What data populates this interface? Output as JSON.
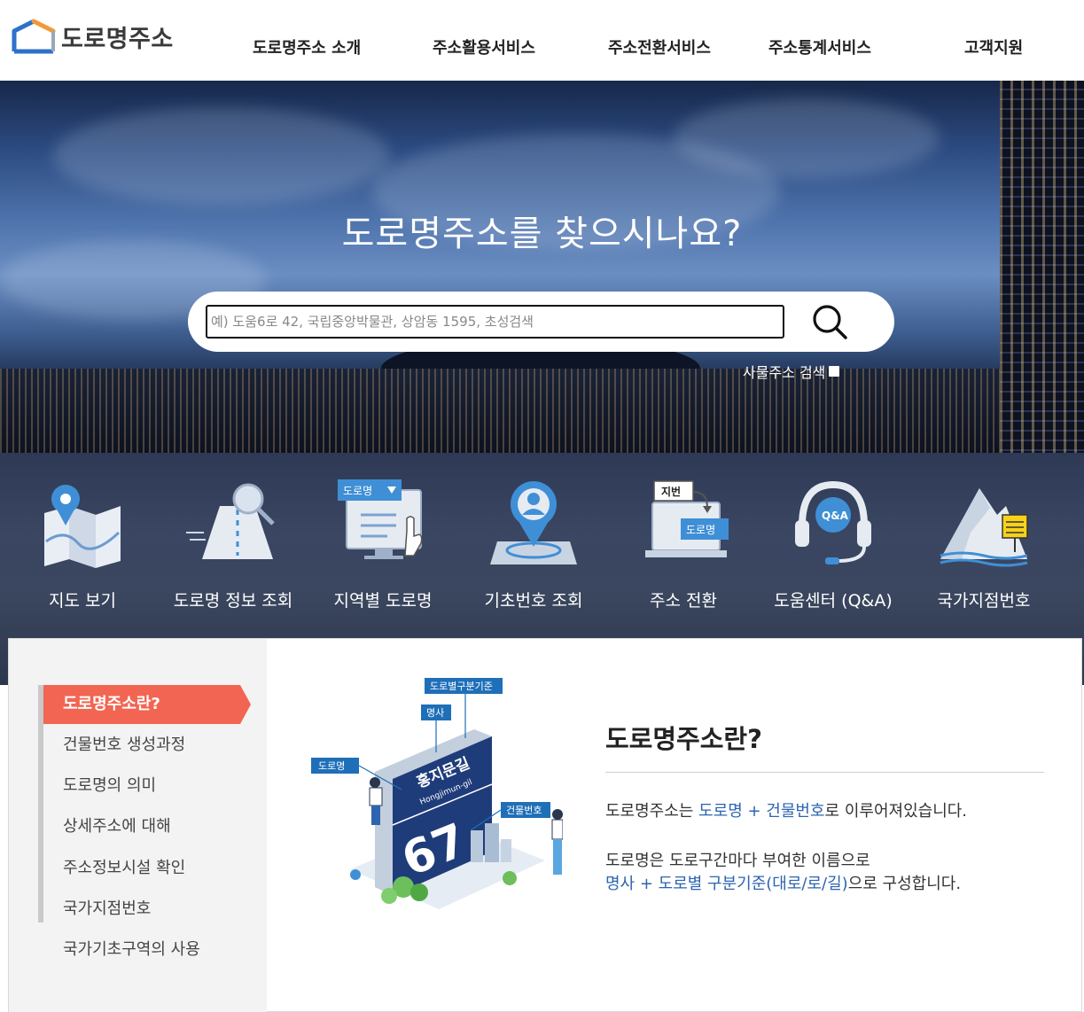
{
  "header": {
    "logo_text": "도로명주소",
    "nav": [
      "도로명주소 소개",
      "주소활용서비스",
      "주소전환서비스",
      "주소통계서비스",
      "고객지원"
    ]
  },
  "hero": {
    "title": "도로명주소를 찾으시나요?",
    "search_placeholder": "예) 도움6로 42, 국립중앙박물관, 상암동 1595, 초성검색",
    "sub_search_label": "사물주소 검색"
  },
  "quick_menu": [
    {
      "label": "지도 보기",
      "icon": "map-icon"
    },
    {
      "label": "도로명 정보 조회",
      "icon": "road-info-icon"
    },
    {
      "label": "지역별 도로명",
      "icon": "region-road-icon"
    },
    {
      "label": "기초번호 조회",
      "icon": "base-number-icon"
    },
    {
      "label": "주소 전환",
      "icon": "address-convert-icon"
    },
    {
      "label": "도움센터 (Q&A)",
      "icon": "help-center-icon"
    },
    {
      "label": "국가지점번호",
      "icon": "national-point-icon"
    }
  ],
  "quick_icon_texts": {
    "road_dropdown": "도로명",
    "jibun": "지번",
    "doro": "도로명",
    "qa": "Q&A"
  },
  "side_menu": [
    {
      "label": "도로명주소란?",
      "active": true
    },
    {
      "label": "건물번호 생성과정",
      "active": false
    },
    {
      "label": "도로명의 의미",
      "active": false
    },
    {
      "label": "상세주소에 대해",
      "active": false
    },
    {
      "label": "주소정보시설 확인",
      "active": false
    },
    {
      "label": "국가지점번호",
      "active": false
    },
    {
      "label": "국가기초구역의 사용",
      "active": false
    }
  ],
  "illustration": {
    "tag_criteria": "도로별구분기준",
    "tag_noun": "명사",
    "tag_road": "도로명",
    "tag_building": "건물번호",
    "sign_road_kr": "홍지문길",
    "sign_road_en": "Hongjimun-gil",
    "sign_number": "67"
  },
  "section": {
    "title": "도로명주소란?",
    "p1_pre": "도로명주소는 ",
    "p1_hl": "도로명 + 건물번호",
    "p1_post": "로 이루어져있습니다.",
    "p2_line1": "도로명은 도로구간마다 부여한 이름으로",
    "p2_hl": "명사 + 도로별 구분기준(대로/로/길)",
    "p2_post": "으로 구성합니다."
  },
  "colors": {
    "accent": "#f26552",
    "link_blue": "#2c64b0",
    "logo_blue": "#2d71c8",
    "logo_orange": "#f29a38"
  }
}
